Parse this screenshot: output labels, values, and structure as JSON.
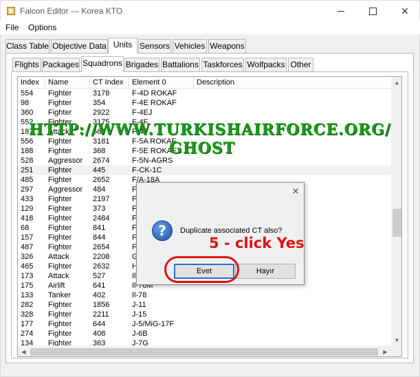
{
  "window": {
    "title": "Falcon Editor --- Korea KTO",
    "minimize_glyph": "",
    "maximize_glyph": "",
    "close_glyph": "✕"
  },
  "menu": [
    "File",
    "Options"
  ],
  "main_tabs": [
    "Class Table",
    "Objective Data",
    "Units",
    "Sensors",
    "Vehicles",
    "Weapons"
  ],
  "main_tab_active": "Units",
  "sub_tabs": [
    "Flights",
    "Packages",
    "Squadrons",
    "Brigades",
    "Battalions",
    "Taskforces",
    "Wolfpacks",
    "Other"
  ],
  "sub_tab_active": "Squadrons",
  "table": {
    "columns": [
      "Index",
      "Name",
      "CT Index",
      "Element 0",
      "Description"
    ],
    "rows": [
      [
        "554",
        "Fighter",
        "3178",
        "F-4D ROKAF"
      ],
      [
        "98",
        "Fighter",
        "354",
        "F-4E ROKAF"
      ],
      [
        "360",
        "Fighter",
        "2922",
        "F-4EJ"
      ],
      [
        "552",
        "Fighter",
        "3175",
        "F-4F"
      ],
      [
        "187",
        "Attack",
        "669",
        "F-4F"
      ],
      [
        "556",
        "Fighter",
        "3181",
        "F-5A ROKAF"
      ],
      [
        "188",
        "Fighter",
        "368",
        "F-5E ROKAF"
      ],
      [
        "528",
        "Aggressor",
        "2674",
        "F-5N-AGRS"
      ],
      [
        "251",
        "Fighter",
        "445",
        "F-CK-1C"
      ],
      [
        "485",
        "Fighter",
        "2652",
        "F/A-18A"
      ],
      [
        "297",
        "Aggressor",
        "484",
        "F"
      ],
      [
        "433",
        "Fighter",
        "2197",
        "F"
      ],
      [
        "129",
        "Fighter",
        "373",
        "F"
      ],
      [
        "418",
        "Fighter",
        "2484",
        "F"
      ],
      [
        "68",
        "Fighter",
        "841",
        "F"
      ],
      [
        "157",
        "Fighter",
        "844",
        "F"
      ],
      [
        "487",
        "Fighter",
        "2654",
        "F"
      ],
      [
        "326",
        "Attack",
        "2208",
        "G"
      ],
      [
        "465",
        "Fighter",
        "2632",
        "H"
      ],
      [
        "173",
        "Attack",
        "527",
        "Il"
      ],
      [
        "175",
        "Airlift",
        "641",
        "Il-76M"
      ],
      [
        "133",
        "Tanker",
        "402",
        "Il-78"
      ],
      [
        "282",
        "Fighter",
        "1856",
        "J-11"
      ],
      [
        "328",
        "Fighter",
        "2211",
        "J-15"
      ],
      [
        "177",
        "Fighter",
        "644",
        "J-5/MiG-17F"
      ],
      [
        "274",
        "Fighter",
        "408",
        "J-6B"
      ],
      [
        "134",
        "Fighter",
        "363",
        "J-7G"
      ]
    ],
    "selected_row": 8
  },
  "scroll_glyphs": {
    "up": "▲",
    "down": "▼",
    "left": "◀",
    "right": "▶"
  },
  "dialog": {
    "icon_glyph": "?",
    "close_glyph": "✕",
    "message": "Duplicate associated CT also?",
    "yes_label": "Evet",
    "no_label": "Hayır"
  },
  "overlay": {
    "url": "HTTP://WWW.TURKISHAIRFORCE.ORG/",
    "name": "GHOST"
  },
  "annotation": {
    "text": "5 - click Yes",
    "color": "#e01010"
  },
  "colors": {
    "watermark": "#1a9b1a",
    "annotation": "#e01010",
    "default_button_border": "#2b6fd6"
  }
}
